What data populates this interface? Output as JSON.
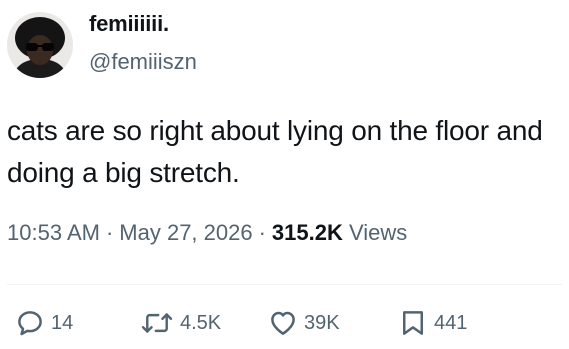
{
  "author": {
    "display_name": "femiiiiii.",
    "handle": "@femiiiszn"
  },
  "tweet": {
    "text": "cats are so right about lying on the floor and doing a big stretch.",
    "time": "10:53 AM",
    "separator": "·",
    "date": "May 27, 2026",
    "views_count": "315.2K",
    "views_label": "Views"
  },
  "actions": {
    "replies": {
      "icon": "reply-icon",
      "count": "14"
    },
    "reposts": {
      "icon": "repost-icon",
      "count": "4.5K"
    },
    "likes": {
      "icon": "heart-icon",
      "count": "39K"
    },
    "bookmarks": {
      "icon": "bookmark-icon",
      "count": "441"
    }
  },
  "colors": {
    "text_primary": "#0f1419",
    "text_secondary": "#536471",
    "divider": "#eff3f4"
  }
}
